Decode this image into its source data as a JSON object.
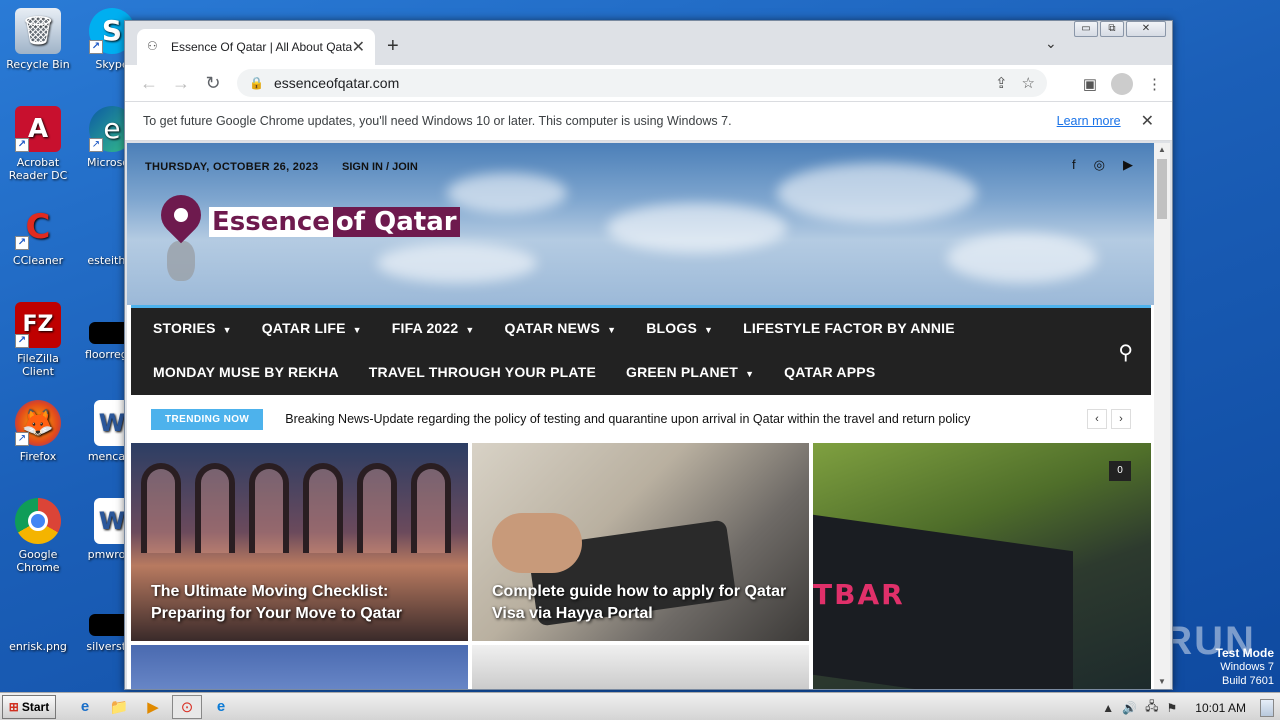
{
  "desktop": {
    "icons": [
      {
        "label": "Recycle Bin",
        "glyph": "🗑"
      },
      {
        "label": "Skype",
        "glyph": "S"
      },
      {
        "label": "Acrobat Reader DC",
        "glyph": "A"
      },
      {
        "label": "Microsoft",
        "glyph": "e"
      },
      {
        "label": "CCleaner",
        "glyph": "C"
      },
      {
        "label": "esteither",
        "glyph": ""
      },
      {
        "label": "FileZilla Client",
        "glyph": "FZ"
      },
      {
        "label": "floorregar",
        "glyph": ""
      },
      {
        "label": "Firefox",
        "glyph": "🦊"
      },
      {
        "label": "mencare",
        "glyph": "W"
      },
      {
        "label": "Google Chrome",
        "glyph": "⊙"
      },
      {
        "label": "pmwrote",
        "glyph": "W"
      },
      {
        "label": "enrisk.png",
        "glyph": ""
      },
      {
        "label": "silverstru",
        "glyph": ""
      }
    ],
    "watermark": "ANY▷RUN",
    "os_info": {
      "line1": "Test Mode",
      "line2": "Windows 7",
      "line3": "Build 7601"
    }
  },
  "browser": {
    "tab": {
      "title": "Essence Of Qatar | All About Qatar",
      "close": "✕"
    },
    "new_tab": "+",
    "tab_menu": "⌄",
    "window_controls": {
      "minimize": "▭",
      "maximize": "⧉",
      "close": "✕"
    },
    "nav": {
      "back": "←",
      "forward": "→",
      "reload": "↻"
    },
    "url": "essenceofqatar.com",
    "lock": "🔒",
    "actions": {
      "share": "⇪",
      "bookmark": "☆",
      "sidepanel": "▣",
      "menu": "⋮"
    },
    "infobar": {
      "message": "To get future Google Chrome updates, you'll need Windows 10 or later. This computer is using Windows 7.",
      "learn_more": "Learn more",
      "close": "✕"
    }
  },
  "site": {
    "date": "THURSDAY, OCTOBER 26, 2023",
    "signin": "SIGN IN / JOIN",
    "social": {
      "facebook": "f",
      "instagram": "◎",
      "youtube": "▶"
    },
    "logo": {
      "part1": "Essence",
      "part2": "of Qatar"
    },
    "nav_row1": [
      {
        "label": "STORIES",
        "caret": "▼"
      },
      {
        "label": "QATAR LIFE",
        "caret": "▼"
      },
      {
        "label": "FIFA 2022",
        "caret": "▼"
      },
      {
        "label": "QATAR NEWS",
        "caret": "▼"
      },
      {
        "label": "BLOGS",
        "caret": "▼"
      },
      {
        "label": "LIFESTYLE FACTOR BY ANNIE",
        "caret": ""
      }
    ],
    "nav_row2": [
      {
        "label": "MONDAY MUSE BY REKHA",
        "caret": ""
      },
      {
        "label": "TRAVEL THROUGH YOUR PLATE",
        "caret": ""
      },
      {
        "label": "GREEN PLANET",
        "caret": "▼"
      },
      {
        "label": "QATAR APPS",
        "caret": ""
      }
    ],
    "search_icon": "⚲",
    "trending": {
      "badge": "TRENDING NOW",
      "headline": "Breaking News-Update regarding the policy of testing and quarantine upon arrival in Qatar within the travel and return policy",
      "prev": "‹",
      "next": "›"
    },
    "cards": [
      {
        "title": "The Ultimate Moving Checklist: Preparing for Your Move to Qatar"
      },
      {
        "title": "Complete guide how to apply for Qatar Visa via Hayya Portal"
      },
      {
        "title": "",
        "overlay_text": "TBAR",
        "comments": "0"
      }
    ]
  },
  "taskbar": {
    "start": "Start",
    "start_flag": "⊞",
    "apps": [
      "e",
      "📁",
      "▶",
      "⊙",
      "e"
    ],
    "clock": "10:01 AM",
    "tray": [
      "▲",
      "🔊",
      "🖧",
      "⚑"
    ]
  }
}
